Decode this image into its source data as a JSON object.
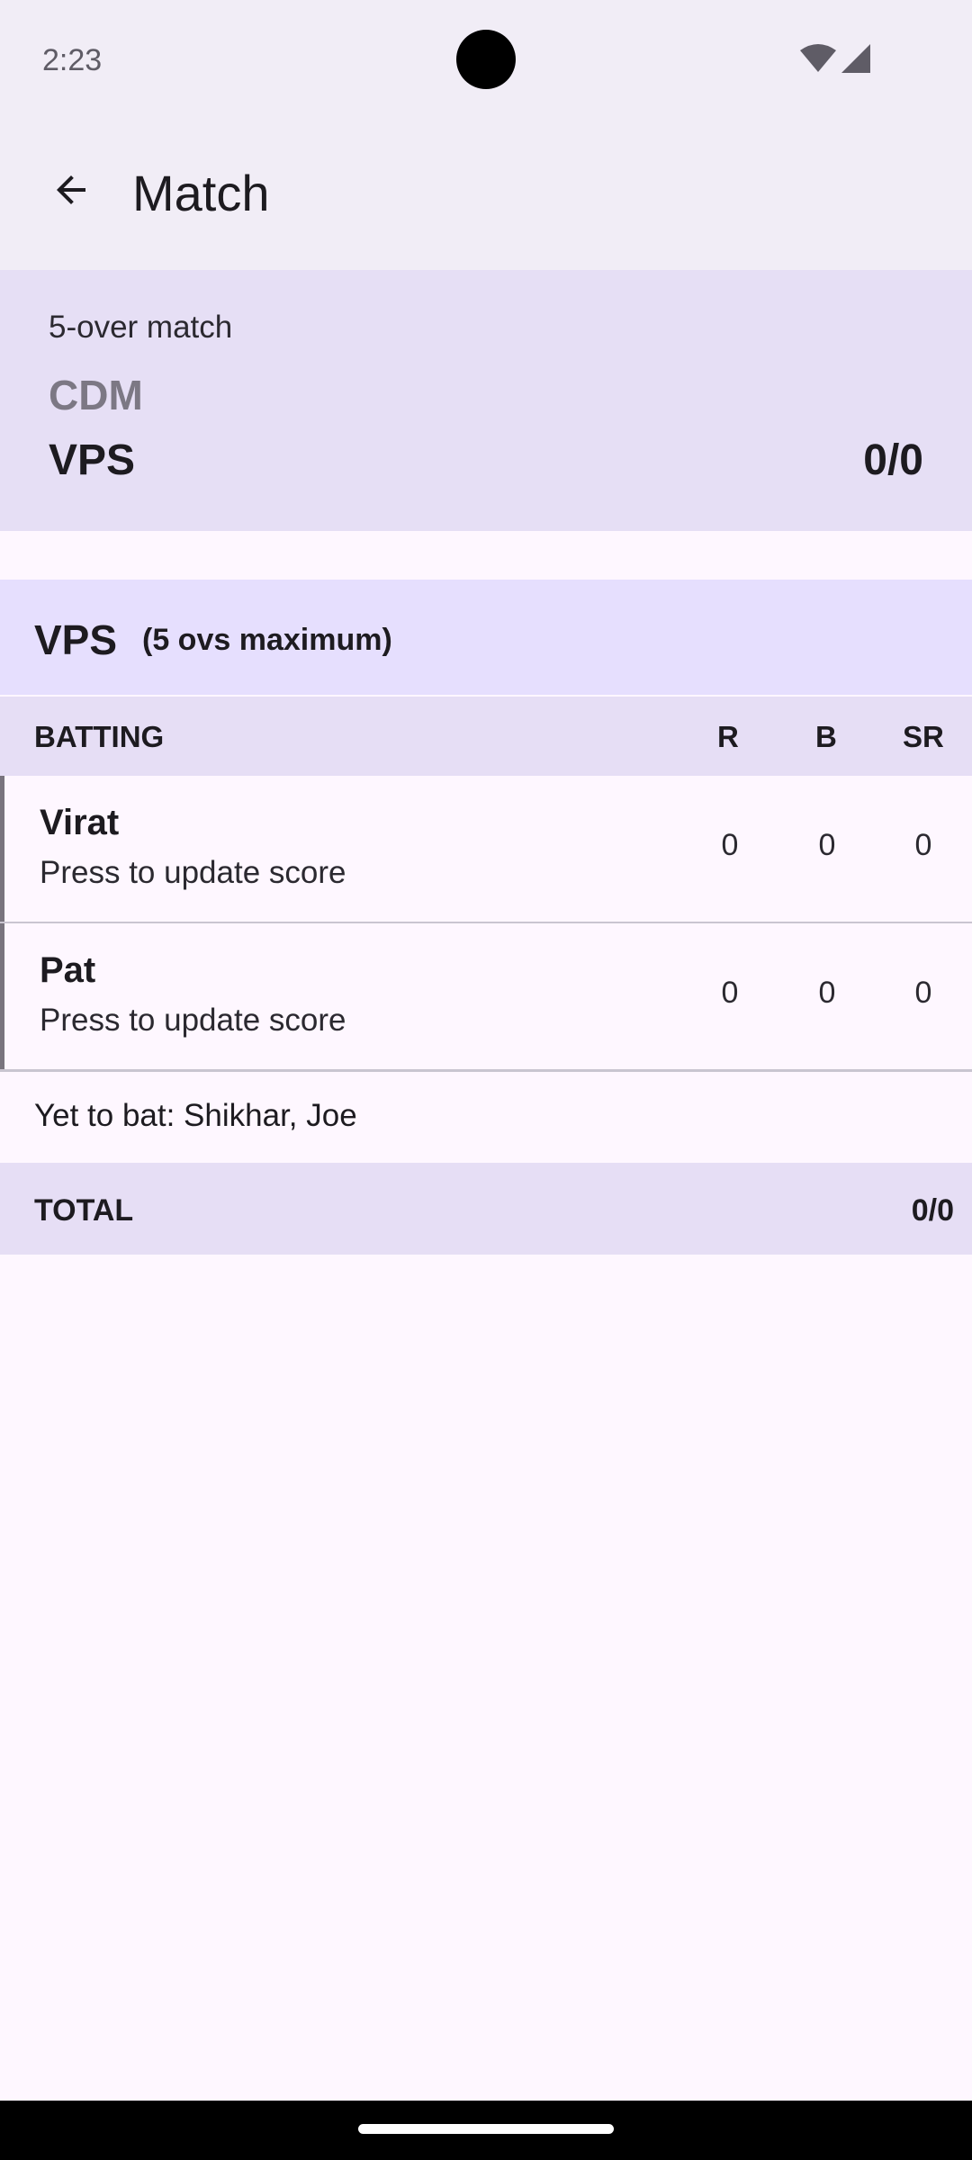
{
  "status_bar": {
    "time": "2:23",
    "icons": [
      "wifi-icon",
      "signal-icon"
    ]
  },
  "app_bar": {
    "back_icon": "arrow-back-icon",
    "title": "Match"
  },
  "match_card": {
    "format": "5-over match",
    "team_1": "CDM",
    "team_2": "VPS",
    "team_2_score": "0/0"
  },
  "innings": {
    "team": "VPS",
    "overs_note": "(5 ovs maximum)"
  },
  "batting_table": {
    "headers": {
      "batting": "BATTING",
      "runs": "R",
      "balls": "B",
      "strike_rate": "SR"
    },
    "rows": [
      {
        "name": "Virat",
        "hint": "Press to update score",
        "runs": "0",
        "balls": "0",
        "strike_rate": "0"
      },
      {
        "name": "Pat",
        "hint": "Press to update score",
        "runs": "0",
        "balls": "0",
        "strike_rate": "0"
      }
    ],
    "yet_to_bat": "Yet to bat: Shikhar, Joe",
    "total_label": "TOTAL",
    "total_value": "0/0"
  },
  "colors": {
    "app_bar_bg": "#f1edf6",
    "match_card_bg": "#e6dff5",
    "innings_header_bg": "#e6dffe",
    "table_header_bg": "#e6def5",
    "page_bg": "#fef7ff",
    "row_accent": "#79747e"
  }
}
